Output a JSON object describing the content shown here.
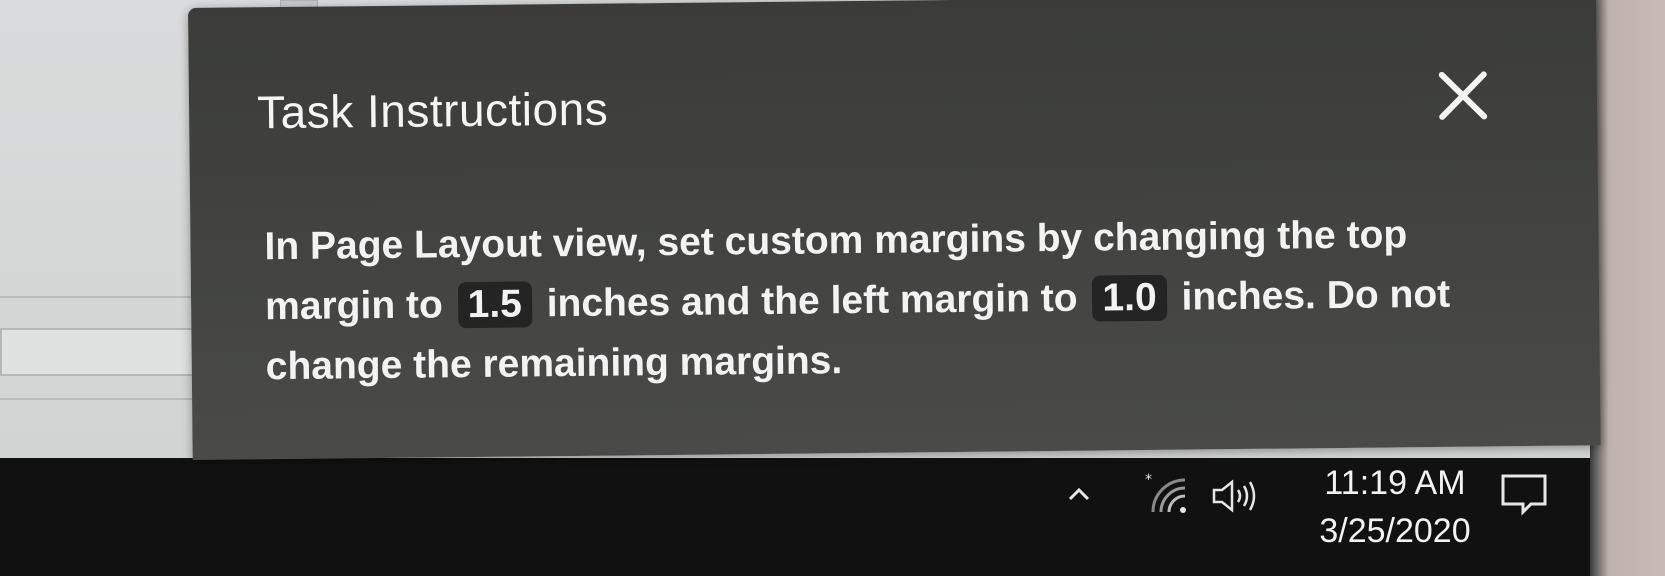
{
  "dialog": {
    "title": "Task Instructions",
    "close_label": "Close",
    "instruction": {
      "part1": "In Page Layout view, set custom margins by changing the top margin to",
      "value1": "1.5",
      "part2": "inches and the left margin to",
      "value2": "1.0",
      "part3": "inches. Do not change the remaining margins."
    }
  },
  "taskbar": {
    "tray_icons": [
      "chevron-up-icon",
      "wifi-icon",
      "volume-icon",
      "notification-icon"
    ],
    "time": "11:19 AM",
    "date": "3/25/2020"
  },
  "colors": {
    "dialog_bg": "#424341",
    "dialog_text": "#f3f3f3",
    "value_chip_bg": "#232423",
    "taskbar_bg": "#111111"
  }
}
